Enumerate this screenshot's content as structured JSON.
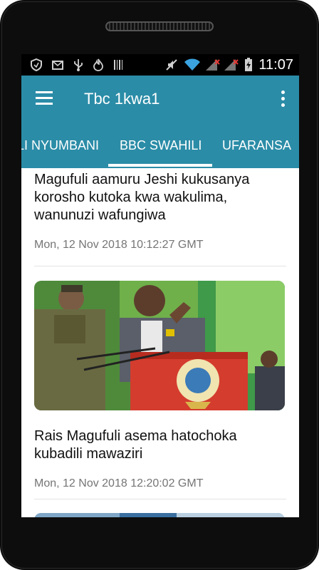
{
  "status_bar": {
    "time": "11:07",
    "icons": [
      "shield-icon",
      "gmail-icon",
      "usb-icon",
      "fire-icon",
      "barcode-icon",
      "mute-icon",
      "wifi-icon",
      "signal-icon",
      "signal-icon",
      "battery-icon"
    ]
  },
  "app_bar": {
    "title": "Tbc 1kwa1"
  },
  "tabs": [
    {
      "label": "LI NYUMBANI"
    },
    {
      "label": "BBC SWAHILI",
      "selected": true
    },
    {
      "label": "UFARANSA"
    }
  ],
  "articles": [
    {
      "headline": "Magufuli aamuru Jeshi kukusanya korosho kutoka kwa wakulima, wanunuzi wafungiwa",
      "date": "Mon, 12 Nov 2018 10:12:27 GMT"
    },
    {
      "headline": "Rais Magufuli asema hatochoka kubadili mawaziri",
      "date": "Mon, 12 Nov 2018 12:20:02 GMT",
      "image": "speaker-at-podium-photo"
    },
    {
      "image": "partial-thumbnail"
    }
  ],
  "colors": {
    "primary": "#2b8ca7",
    "tab_indicator": "#ffffff",
    "meta_text": "#757575"
  }
}
